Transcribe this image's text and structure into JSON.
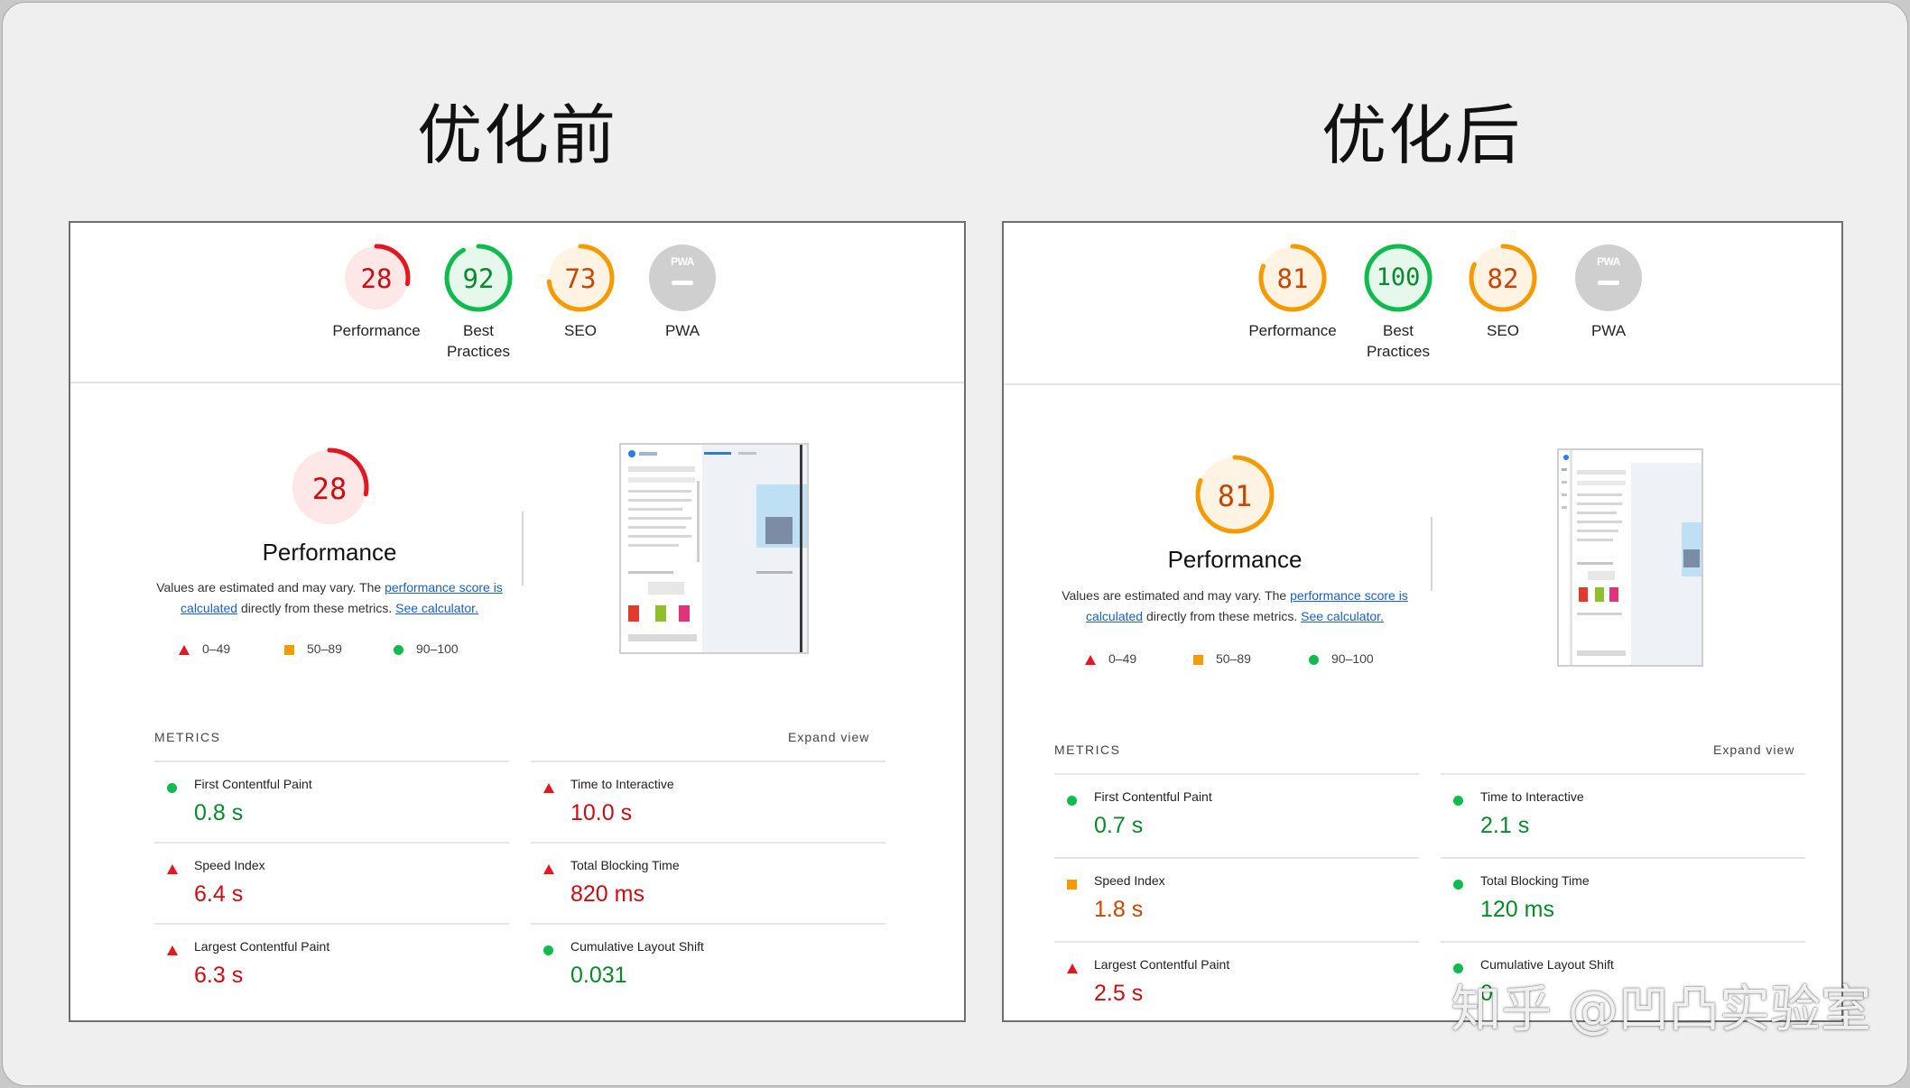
{
  "left": {
    "heading": "优化前",
    "categories": [
      {
        "score": "28",
        "value": 28,
        "label": "Performance",
        "color": "#e4161f",
        "bg": "#fde8e7",
        "text": "#cc0d12"
      },
      {
        "score": "92",
        "value": 92,
        "label": "Best Practices",
        "color": "#10bb4e",
        "bg": "#e6f8ec",
        "text": "#078a2a"
      },
      {
        "score": "73",
        "value": 73,
        "label": "SEO",
        "color": "#f59b00",
        "bg": "#fff4e3",
        "text": "#c74600"
      }
    ],
    "pwa": {
      "badge": "PWA",
      "label": "PWA"
    },
    "performance": {
      "score": "28",
      "value": 28,
      "color": "#e4161f",
      "bg": "#fde8e7",
      "text": "#cc0d12",
      "title": "Performance",
      "desc_prefix": "Values are estimated and may vary. The ",
      "link1": "performance score is calculated",
      "desc_middle": " directly from these metrics. ",
      "link2": "See calculator."
    },
    "legend": {
      "red": "0–49",
      "orange": "50–89",
      "green": "90–100"
    },
    "metrics_label": "METRICS",
    "expand_label": "Expand view",
    "metrics": [
      {
        "name": "First Contentful Paint",
        "value": "0.8 s",
        "rating": "good"
      },
      {
        "name": "Time to Interactive",
        "value": "10.0 s",
        "rating": "bad"
      },
      {
        "name": "Speed Index",
        "value": "6.4 s",
        "rating": "bad"
      },
      {
        "name": "Total Blocking Time",
        "value": "820 ms",
        "rating": "bad"
      },
      {
        "name": "Largest Contentful Paint",
        "value": "6.3 s",
        "rating": "bad"
      },
      {
        "name": "Cumulative Layout Shift",
        "value": "0.031",
        "rating": "good"
      }
    ]
  },
  "right": {
    "heading": "优化后",
    "categories": [
      {
        "score": "81",
        "value": 81,
        "label": "Performance",
        "color": "#f59b00",
        "bg": "#fff4e3",
        "text": "#c74600"
      },
      {
        "score": "100",
        "value": 100,
        "label": "Best Practices",
        "color": "#10bb4e",
        "bg": "#e6f8ec",
        "text": "#078a2a"
      },
      {
        "score": "82",
        "value": 82,
        "label": "SEO",
        "color": "#f59b00",
        "bg": "#fff4e3",
        "text": "#c74600"
      }
    ],
    "pwa": {
      "badge": "PWA",
      "label": "PWA"
    },
    "performance": {
      "score": "81",
      "value": 81,
      "color": "#f59b00",
      "bg": "#fff4e3",
      "text": "#c74600",
      "title": "Performance",
      "desc_prefix": "Values are estimated and may vary. The ",
      "link1": "performance score is calculated",
      "desc_middle": " directly from these metrics. ",
      "link2": "See calculator."
    },
    "legend": {
      "red": "0–49",
      "orange": "50–89",
      "green": "90–100"
    },
    "metrics_label": "METRICS",
    "expand_label": "Expand view",
    "metrics": [
      {
        "name": "First Contentful Paint",
        "value": "0.7 s",
        "rating": "good"
      },
      {
        "name": "Time to Interactive",
        "value": "2.1 s",
        "rating": "good"
      },
      {
        "name": "Speed Index",
        "value": "1.8 s",
        "rating": "avg"
      },
      {
        "name": "Total Blocking Time",
        "value": "120 ms",
        "rating": "good"
      },
      {
        "name": "Largest Contentful Paint",
        "value": "2.5 s",
        "rating": "bad"
      },
      {
        "name": "Cumulative Layout Shift",
        "value": "0",
        "rating": "good"
      }
    ]
  },
  "watermark": "知乎 @凹凸实验室",
  "colors": {
    "pwa_gray": "#cfcfcf",
    "link": "#1a5fc4"
  }
}
